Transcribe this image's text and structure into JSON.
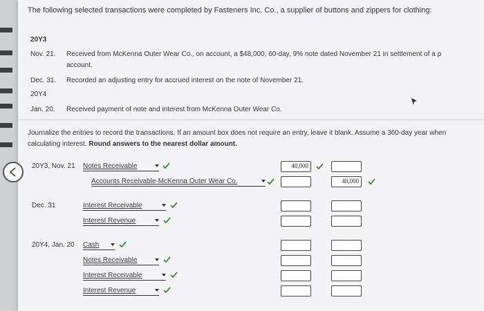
{
  "intro": "The following selected transactions were completed by Fasteners Inc. Co., a supplier of buttons and zippers for clothing:",
  "transactions": {
    "year1": "20Y3",
    "t1_date": "Nov. 21.",
    "t1_line1": "Received from McKenna Outer Wear Co., on account, a $48,000, 60-day, 9% note dated November 21 in settlement of a p",
    "t1_line2": "account.",
    "t2_date": "Dec. 31.",
    "t2_text": "Recorded an adjusting entry for accrued interest on the note of November 21.",
    "year2": "20Y4",
    "t3_date": "Jan. 20.",
    "t3_text": "Received payment of note and interest from McKenna Outer Wear Co."
  },
  "question": {
    "text": "Journalize the entries to record the transactions. If an amount box does not require an entry, leave it blank. Assume a 360-day year when calculating interest.",
    "bold": "Round answers to the nearest dollar amount."
  },
  "journal": {
    "e1_date": "20Y3, Nov. 21",
    "e1_a1": "Notes Receivable",
    "e1_a1_debit": "48,000",
    "e1_a2": "Accounts Receivable-McKenna Outer Wear Co.",
    "e1_a2_credit": "48,000",
    "e2_date": "Dec. 31",
    "e2_a1": "Interest Receivable",
    "e2_a2": "Interest Revenue",
    "e3_date": "20Y4, Jan. 20",
    "e3_a1": "Cash",
    "e3_a2": "Notes Receivable",
    "e3_a3": "Interest Receivable",
    "e3_a4": "Interest Revenue"
  },
  "colors": {
    "check": "#3f8a3a",
    "page": "#f4f4f6"
  }
}
